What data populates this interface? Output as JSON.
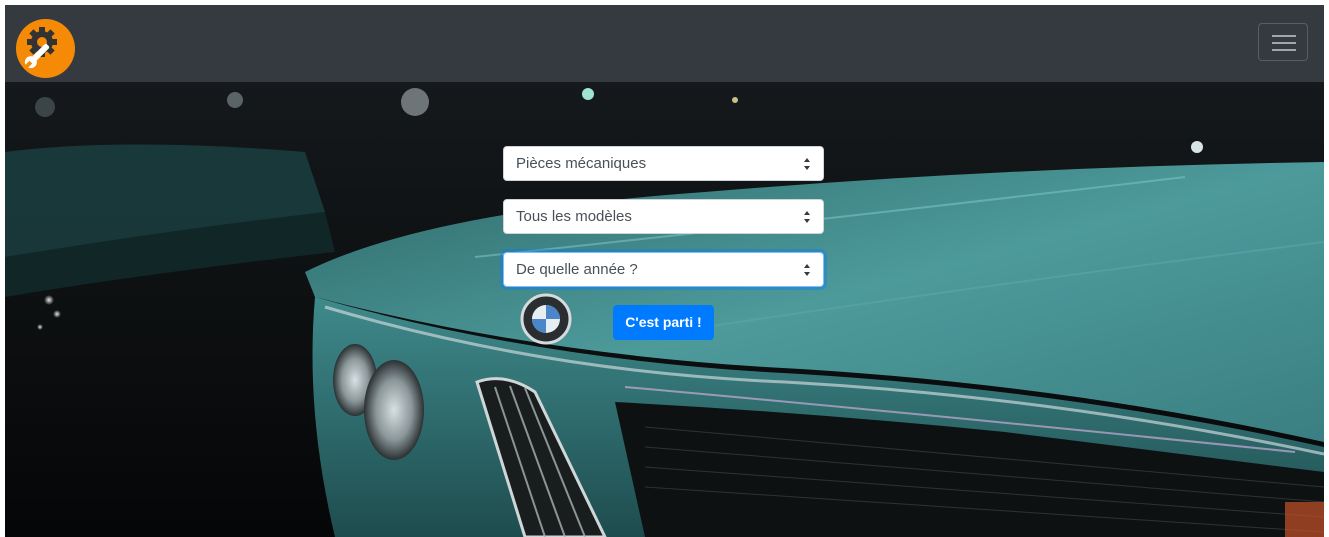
{
  "navbar": {
    "logo_icon": "wrench-gear-icon",
    "menu_icon": "hamburger-menu-icon",
    "background": "#343a40",
    "logo_color": "#f58a07"
  },
  "search_form": {
    "category_select": {
      "selected": "Pièces mécaniques"
    },
    "model_select": {
      "selected": "Tous les modèles"
    },
    "year_select": {
      "selected": "De quelle année ?"
    },
    "submit_label": "C'est parti !"
  },
  "hero": {
    "image_subject": "teal-classic-bmw-car"
  },
  "colors": {
    "accent": "#007bff",
    "car_teal": "#3d8a8a"
  }
}
